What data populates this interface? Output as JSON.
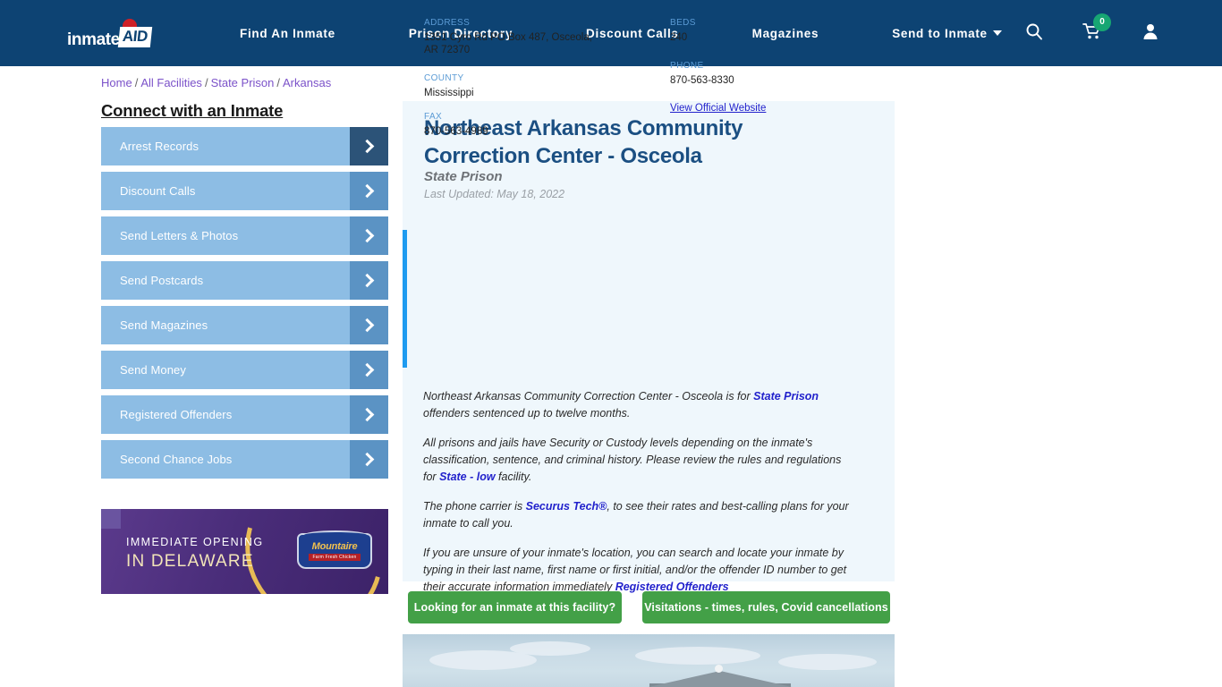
{
  "nav": {
    "logo_primary": "inmate",
    "logo_secondary": "AID",
    "links": [
      {
        "label": "Find An Inmate"
      },
      {
        "label": "Prison Directory"
      },
      {
        "label": "Discount Calls"
      },
      {
        "label": "Magazines"
      },
      {
        "label": "Send to Inmate"
      }
    ],
    "search_icon": "search-icon",
    "cart_icon": "cart-icon",
    "cart_count": "0",
    "account_icon": "user-icon"
  },
  "breadcrumb": {
    "items": [
      "Home",
      "All Facilities",
      "State Prison",
      "Arkansas"
    ],
    "separator": "/"
  },
  "sidebar": {
    "title": "Connect with an Inmate",
    "items": [
      {
        "label": "Arrest Records"
      },
      {
        "label": "Discount Calls"
      },
      {
        "label": "Send Letters & Photos"
      },
      {
        "label": "Send Postcards"
      },
      {
        "label": "Send Magazines"
      },
      {
        "label": "Send Money"
      },
      {
        "label": "Registered Offenders"
      },
      {
        "label": "Second Chance Jobs"
      }
    ]
  },
  "ad": {
    "line1": "IMMEDIATE OPENING",
    "line2": "IN DELAWARE",
    "brand": "Mountaire",
    "brand_sub": "Farm Fresh Chicken"
  },
  "facility": {
    "title": "Northeast Arkansas Community Correction Center - Osceola",
    "type": "State Prison",
    "last_updated": "Last Updated: May 18, 2022",
    "fields": {
      "address_label": "ADDRESS",
      "address_value": "1351 Cyro Rd PO Box 487, Osceola, AR 72370",
      "county_label": "COUNTY",
      "county_value": "Mississippi",
      "fax_label": "FAX",
      "fax_value": "870-563-4989",
      "beds_label": "BEDS",
      "beds_value": "240",
      "phone_label": "PHONE",
      "phone_value": "870-563-8330",
      "website_link": "View Official Website"
    }
  },
  "description": {
    "p1_a": "Northeast Arkansas Community Correction Center - Osceola is for ",
    "p1_link": "State Prison",
    "p1_b": " offenders sentenced up to twelve months.",
    "p2_a": "All prisons and jails have Security or Custody levels depending on the inmate's classification, sentence, and criminal history. Please review the rules and regulations for ",
    "p2_link": "State - low",
    "p2_b": " facility.",
    "p3_a": "The phone carrier is ",
    "p3_link": "Securus Tech®",
    "p3_b": ", to see their rates and best-calling plans for your inmate to call you.",
    "p4_a": "If you are unsure of your inmate's location, you can search and locate your inmate by typing in their last name, first name or first initial, and/or the offender ID number to get their accurate information immediately ",
    "p4_link": "Registered Offenders"
  },
  "actions": {
    "find_inmate": "Looking for an inmate at this facility?",
    "visitations": "Visitations - times, rules, Covid cancellations"
  },
  "colors": {
    "nav_blue": "#0d4373",
    "panel_bg": "#eff7fc",
    "accent_blue": "#1e9bf0",
    "title_blue": "#1b4f82",
    "sidebar_blue": "#8dbde4",
    "sidebar_arrow": "#5b93c4",
    "sidebar_arrow_active": "#2c5378",
    "green_button": "#43a047",
    "link_purple": "#7b52c9",
    "link_blue": "#2222cc",
    "badge_green": "#17a673"
  }
}
